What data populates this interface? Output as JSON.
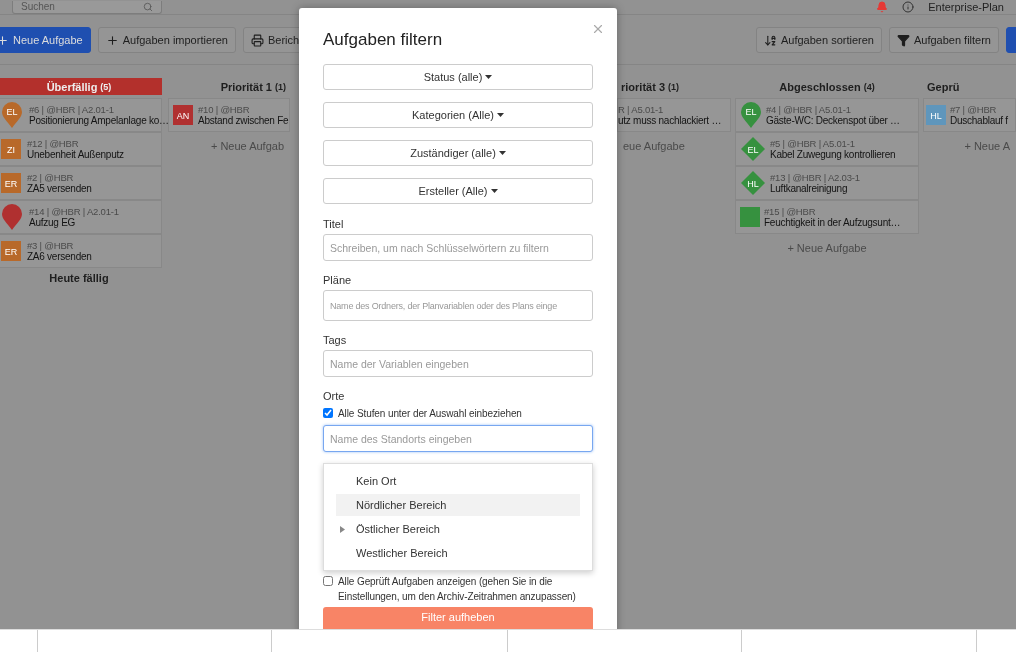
{
  "topbar": {
    "search_placeholder": "Suchen",
    "plan": "Enterprise-Plan"
  },
  "toolbar": {
    "left": [
      {
        "label": "Neue Aufgabe",
        "kind": "primary"
      },
      {
        "label": "Aufgaben importieren",
        "kind": "default"
      },
      {
        "label": "Berich",
        "kind": "default"
      }
    ],
    "right": [
      {
        "label": "Aufgaben sortieren",
        "kind": "default"
      },
      {
        "label": "Aufgaben filtern",
        "kind": "default"
      },
      {
        "kind": "primary"
      }
    ]
  },
  "columns": [
    {
      "title": "Überfällig",
      "count": "(5)",
      "overdue": true,
      "cards": [
        {
          "meta": "#6 | @HBR | A2.01-1",
          "title": "Positionierung Ampelanlage ko…",
          "kind": "pin",
          "color": "#b8692a",
          "initials": "EL"
        },
        {
          "meta": "#12 | @HBR",
          "title": "Unebenheit Außenputz",
          "kind": "square",
          "color": "#b8692a",
          "initials": "ZI"
        },
        {
          "meta": "#2 | @HBR",
          "title": "ZA5 versenden",
          "kind": "square",
          "color": "#b8692a",
          "initials": "ER"
        },
        {
          "meta": "#14 | @HBR | A2.01-1",
          "title": "Aufzug EG",
          "kind": "pin",
          "color": "#b03030"
        },
        {
          "meta": "#3 | @HBR",
          "title": "ZA6 versenden",
          "kind": "square",
          "color": "#b8692a",
          "initials": "ER"
        }
      ],
      "footer": "Heute fällig"
    },
    {
      "title": "Priorität 1",
      "count": "(1)",
      "overdue": false,
      "cards": [
        {
          "meta": "#10 | @HBR",
          "title": "Abstand zwischen Fe",
          "kind": "square",
          "color": "#b03030",
          "initials": "AN"
        }
      ],
      "add": "+ Neue Aufgab"
    },
    {
      "title": "riorität 3",
      "count": "(1)",
      "overdue": false,
      "cards": [
        {
          "meta": "R | A5.01-1",
          "title": "utz muss nachlackiert …",
          "kind": "none"
        }
      ],
      "add": "eue Aufgabe"
    },
    {
      "title": "Abgeschlossen",
      "count": "(4)",
      "overdue": false,
      "cards": [
        {
          "meta": "#4 | @HBR | A5.01-1",
          "title": "Gäste-WC: Deckenspot über …",
          "kind": "pin",
          "color": "#36913f",
          "initials": "EL"
        },
        {
          "meta": "#5 | @HBR | A5.01-1",
          "title": "Kabel Zuwegung kontrollieren",
          "kind": "diamond",
          "color": "#36913f",
          "initials": "EL"
        },
        {
          "meta": "#13 | @HBR | A2.03-1",
          "title": "Luftkanalreinigung",
          "kind": "diamond",
          "color": "#36913f",
          "initials": "HL"
        },
        {
          "meta": "#15 | @HBR",
          "title": "Feuchtigkeit in der Aufzugsunt…",
          "kind": "square",
          "color": "#36913f"
        }
      ],
      "add": "+ Neue Aufgabe"
    },
    {
      "title": "Geprü",
      "overdue": false,
      "cards": [
        {
          "meta": "#7 | @HBR",
          "title": "Duschablauf f",
          "kind": "square",
          "color": "#5f96bc",
          "initials": "HL"
        }
      ],
      "add": "+ Neue A"
    }
  ],
  "modal": {
    "title": "Aufgaben filtern",
    "dropdowns": [
      "Status (alle)",
      "Kategorien (Alle)",
      "Zuständiger (alle)",
      "Ersteller (Alle)"
    ],
    "fields": [
      {
        "label": "Titel",
        "placeholder": "Schreiben, um nach Schlüsselwörtern zu filtern",
        "tall": false
      },
      {
        "label": "Pläne",
        "placeholder": "Name des Ordners, der Planvariablen oder des Plans einge",
        "tall": true
      },
      {
        "label": "Tags",
        "placeholder": "Name der Variablen eingeben",
        "tall": false
      }
    ],
    "locations": {
      "label": "Orte",
      "include_levels": {
        "label": "Alle Stufen unter der Auswahl einbeziehen",
        "checked": true
      },
      "placeholder": "Name des Standorts eingeben",
      "focused": true,
      "options": [
        {
          "label": "Kein Ort",
          "hovered": false,
          "has_children": false
        },
        {
          "label": "Nördlicher Bereich",
          "hovered": true,
          "has_children": false
        },
        {
          "label": "Östlicher Bereich",
          "hovered": false,
          "has_children": true
        },
        {
          "label": "Westlicher Bereich",
          "hovered": false,
          "has_children": false
        }
      ]
    },
    "show_checked": {
      "label": "Alle Geprüft Aufgaben anzeigen (gehen Sie in die Einstellungen, um den Archiv-Zeitrahmen anzupassen)",
      "checked": false
    },
    "reset_button": "Filter aufheben"
  }
}
